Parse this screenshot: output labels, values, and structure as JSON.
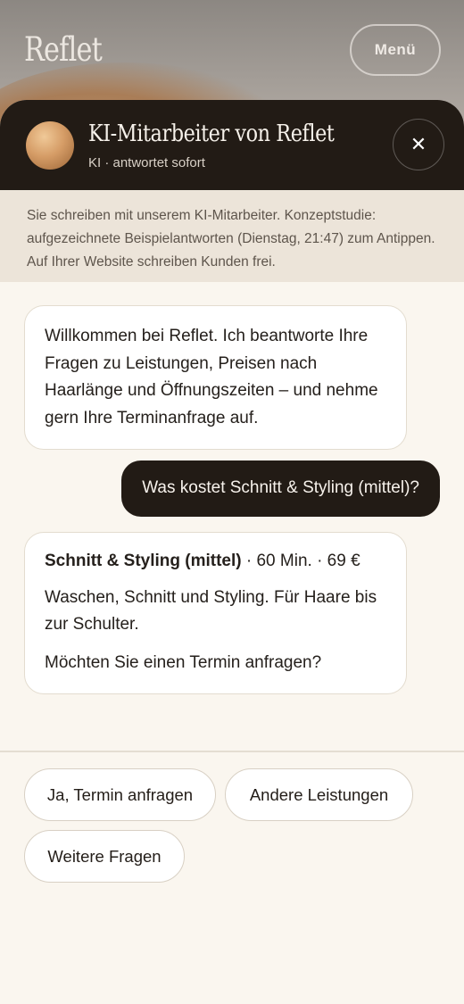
{
  "site": {
    "logo": "Reflet",
    "menu_label": "Menü"
  },
  "chat": {
    "agent_name": "KI-Mitarbeiter von Reflet",
    "agent_status": "KI · antwortet sofort",
    "close_label": "✕",
    "notice": "Sie schreiben mit unserem KI-Mitarbeiter. Konzeptstudie: aufgezeichnete Beispielantworten (Dienstag, 21:47) zum Antippen. Auf Ihrer Website schreiben Kunden frei.",
    "messages": [
      {
        "from": "bot",
        "text": "Willkommen bei Reflet. Ich beantworte Ihre Fragen zu Leistungen, Preisen nach Haarlänge und Öffnungszeiten – und nehme gern Ihre Terminanfrage auf."
      },
      {
        "from": "user",
        "text": "Was kostet Schnitt & Styling (mittel)?"
      },
      {
        "from": "bot",
        "service_name": "Schnitt & Styling (mittel)",
        "service_meta": " · 60 Min. · 69 €",
        "description": "Waschen, Schnitt und Styling. Für Haare bis zur Schulter.",
        "question": "Möchten Sie einen Termin anfragen?"
      }
    ],
    "quick_replies": [
      "Ja, Termin anfragen",
      "Andere Leistungen",
      "Weitere Fragen"
    ]
  },
  "colors": {
    "header_dark": "#221b15",
    "notice_bg": "#ece4d9",
    "chat_bg": "#faf6ef",
    "accent_avatar": "#d59c66"
  }
}
